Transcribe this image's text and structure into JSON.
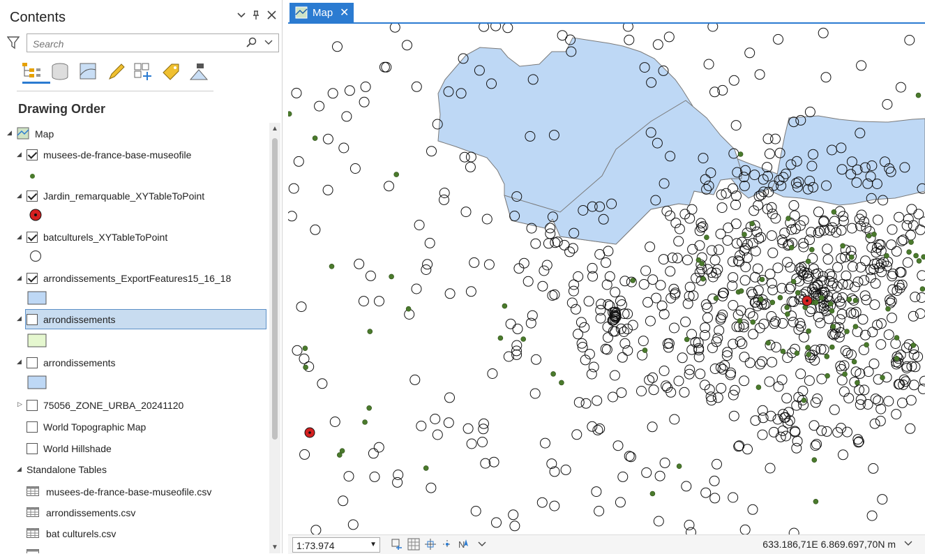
{
  "contents": {
    "title": "Contents",
    "search_placeholder": "Search",
    "section": "Drawing Order",
    "tools": [
      "list-by-drawing-order-icon",
      "list-by-source-icon",
      "list-by-selection-icon",
      "list-by-editing-icon",
      "list-by-snapping-icon",
      "list-by-labeling-icon",
      "list-by-perspective-imagery-icon"
    ],
    "tree": {
      "map": "Map",
      "layers": [
        {
          "name": "musees-de-france-base-museofile",
          "checked": true
        },
        {
          "name": "Jardin_remarquable_XYTableToPoint",
          "checked": true
        },
        {
          "name": "batculturels_XYTableToPoint",
          "checked": true
        },
        {
          "name": "arrondissements_ExportFeatures15_16_18",
          "checked": true
        },
        {
          "name": "arrondissements",
          "checked": false,
          "selected": true
        },
        {
          "name": "arrondissements",
          "checked": false
        },
        {
          "name": "75056_ZONE_URBA_20241120",
          "checked": false
        },
        {
          "name": "World Topographic Map",
          "checked": false
        },
        {
          "name": "World Hillshade",
          "checked": false
        }
      ],
      "standalone_header": "Standalone Tables",
      "tables": [
        "musees-de-france-base-museofile.csv",
        "arrondissements.csv",
        "bat culturels.csv"
      ]
    },
    "colors": {
      "museum": "#4a7a2c",
      "garden": "#d42020",
      "polygon_blue": "#bed8f5",
      "polygon_green": "#e5f7cf"
    }
  },
  "map": {
    "tab_title": "Map",
    "scale": "1:73.974",
    "coordinates": "633.186,71E 6.869.697,70N m",
    "polygon_fill": "#bed8f5",
    "polygon_stroke": "#7a7a7a"
  }
}
